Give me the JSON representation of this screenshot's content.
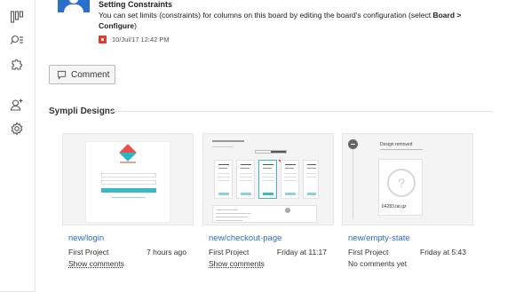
{
  "activity": {
    "title": "Setting Constraints",
    "body_prefix": "You can set limits (constraints) for columns on this board by editing the board's configuration (select ",
    "body_bold": "Board > Configure",
    "body_suffix": ")",
    "timestamp": "10/Jul/17 12:42 PM"
  },
  "comment_button": {
    "label": "Comment"
  },
  "section": {
    "title": "Sympli Designs"
  },
  "designs": [
    {
      "name": "new/login",
      "project": "First Project",
      "time": "7 hours ago",
      "comments": "Show comments"
    },
    {
      "name": "new/checkout-page",
      "project": "First Project",
      "time": "Friday at 11:17",
      "comments": "Show comments"
    },
    {
      "name": "new/empty-state",
      "project": "First Project",
      "time": "Friday at 5:43",
      "comments": "No comments yet"
    }
  ],
  "empty_state_thumb": {
    "title": "Design removed",
    "question": "?",
    "filename": "64283.tar.gz"
  },
  "colors": {
    "accent": "#2a6fc9",
    "red": "#e23b2e",
    "teal": "#39b8c8"
  },
  "sidebar_icons": [
    "board-icon",
    "issues-search-icon",
    "components-puzzle-icon",
    "add-user-icon",
    "settings-gear-icon"
  ]
}
